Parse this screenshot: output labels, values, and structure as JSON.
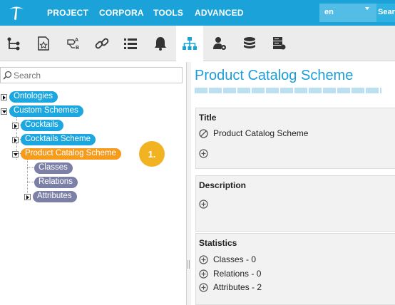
{
  "menu": {
    "project": "PROJECT",
    "corpora": "CORPORA",
    "tools": "TOOLS",
    "advanced": "ADVANCED",
    "language": "en",
    "search_label": "Sear"
  },
  "toolbar": {
    "icons": [
      "hierarchy-icon",
      "starred-document-icon",
      "concept-link-icon",
      "link-icon",
      "list-icon",
      "bell-icon",
      "schema-icon",
      "user-settings-icon",
      "database-icon",
      "server-icon"
    ],
    "active": "schema-icon"
  },
  "left": {
    "search_placeholder": "Search",
    "tree": {
      "ontologies": "Ontologies",
      "custom_schemes": "Custom Schemes",
      "cocktails": "Cocktails",
      "cocktails_scheme": "Cocktails Scheme",
      "product_catalog_scheme": "Product Catalog Scheme",
      "classes": "Classes",
      "relations": "Relations",
      "attributes": "Attributes"
    },
    "step_badge": "1."
  },
  "right": {
    "title": "Product Catalog Scheme",
    "title_section": {
      "label": "Title",
      "value": "Product Catalog Scheme"
    },
    "description_section": {
      "label": "Description"
    },
    "statistics_section": {
      "label": "Statistics",
      "classes": "Classes - 0",
      "relations": "Relations - 0",
      "attributes": "Attributes - 2"
    }
  },
  "colors": {
    "brand": "#1ba3d9",
    "node_blue": "#1ca7e0",
    "node_selected": "#f79b1c",
    "node_leaf": "#7c7fa6",
    "badge": "#f2b322"
  }
}
